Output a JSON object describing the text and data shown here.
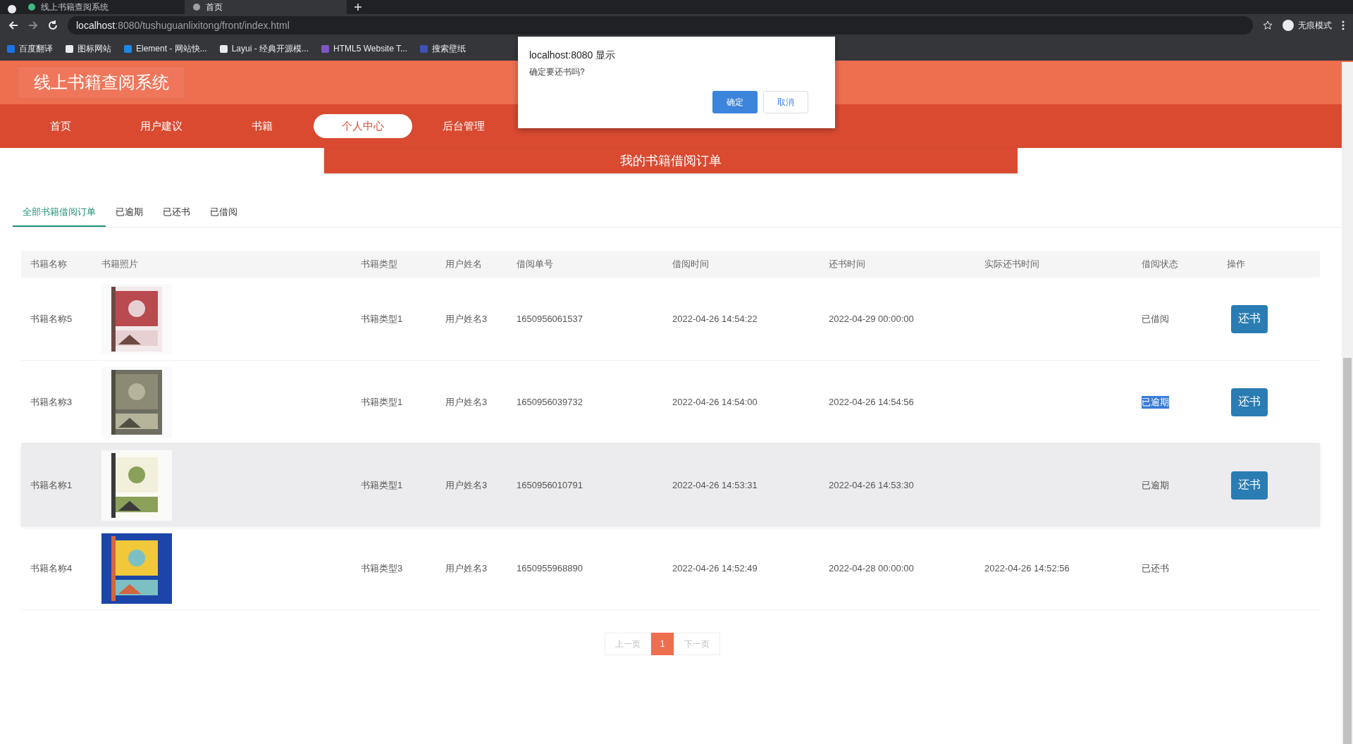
{
  "browser": {
    "tabs": [
      {
        "title": "线上书籍查阅系统",
        "selected": false
      },
      {
        "title": "首页",
        "selected": true
      }
    ],
    "address": {
      "host": "localhost",
      "path": ":8080/tushuguanlixitong/front/index.html"
    },
    "profile": "无痕模式",
    "bookmarks": [
      "百度翻译",
      "图标网站",
      "Element - 网站快...",
      "Layui - 经典开源模...",
      "HTML5 Website T...",
      "搜索壁纸"
    ]
  },
  "site": {
    "title": "线上书籍查阅系统",
    "nav": [
      {
        "label": "首页",
        "selected": false
      },
      {
        "label": "用户建议",
        "selected": false
      },
      {
        "label": "书籍",
        "selected": false
      },
      {
        "label": "个人中心",
        "selected": true
      },
      {
        "label": "后台管理",
        "selected": false
      }
    ]
  },
  "banner": "我的书籍借阅订单",
  "filter_tabs": [
    {
      "label": "全部书籍借阅订单",
      "selected": true
    },
    {
      "label": "已逾期",
      "selected": false
    },
    {
      "label": "已还书",
      "selected": false
    },
    {
      "label": "已借阅",
      "selected": false
    }
  ],
  "table": {
    "columns": [
      "书籍名称",
      "书籍照片",
      "书籍类型",
      "用户姓名",
      "借阅单号",
      "借阅时间",
      "还书时间",
      "实际还书时间",
      "借阅状态",
      "操作"
    ],
    "rows": [
      {
        "name": "书籍名称5",
        "type": "书籍类型1",
        "user": "用户姓名3",
        "order_no": "1650956061537",
        "borrow_time": "2022-04-26 14:54:22",
        "return_time": "2022-04-29 00:00:00",
        "status": "已借阅",
        "status_selected": false,
        "highlighted": false,
        "action": "还书"
      },
      {
        "name": "书籍名称3",
        "type": "书籍类型1",
        "user": "用户姓名3",
        "order_no": "1650956039732",
        "borrow_time": "2022-04-26 14:54:00",
        "return_time": "2022-04-26 14:54:56",
        "status": "已逾期",
        "status_selected": true,
        "highlighted": false,
        "action": "还书"
      },
      {
        "name": "书籍名称1",
        "type": "书籍类型1",
        "user": "用户姓名3",
        "order_no": "1650956010791",
        "borrow_time": "2022-04-26 14:53:31",
        "return_time": "2022-04-26 14:53:30",
        "status": "已逾期",
        "status_selected": false,
        "highlighted": true,
        "action": "还书"
      },
      {
        "name": "书籍名称4",
        "type": "书籍类型3",
        "user": "用户姓名3",
        "order_no": "1650955968890",
        "borrow_time": "2022-04-26 14:52:49",
        "return_time": "2022-04-28 00:00:00",
        "actual_return_time": "2022-04-26 14:52:56",
        "status": "已还书",
        "status_selected": false,
        "highlighted": false
      }
    ]
  },
  "pagination": [
    {
      "label": "上一页",
      "selected": false
    },
    {
      "label": "1",
      "selected": true
    },
    {
      "label": "下一页",
      "selected": false
    }
  ],
  "dialog": {
    "title": "localhost:8080 显示",
    "message": "确定要还书吗?",
    "buttons": [
      {
        "label": "确定",
        "kind": "primary"
      },
      {
        "label": "取消",
        "kind": "secondary"
      }
    ]
  }
}
